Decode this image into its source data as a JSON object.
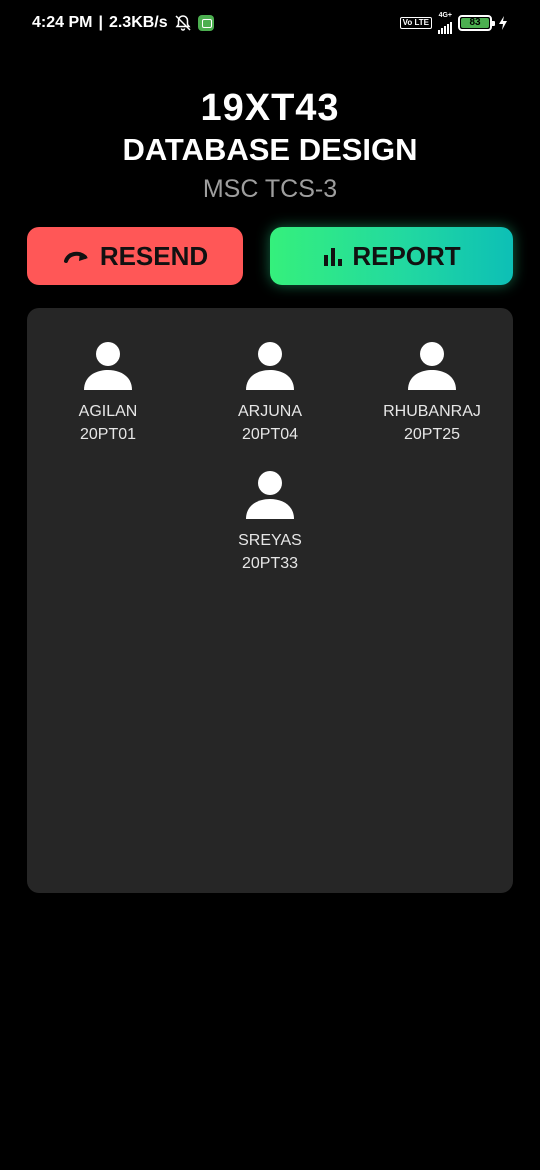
{
  "status_bar": {
    "time": "4:24 PM",
    "speed": "2.3KB/s",
    "volte": "Vo LTE",
    "network": "4G+",
    "battery": "83"
  },
  "course": {
    "code": "19XT43",
    "name": "DATABASE DESIGN",
    "group": "MSC TCS-3"
  },
  "buttons": {
    "resend": "RESEND",
    "report": "REPORT"
  },
  "members": [
    {
      "name": "AGILAN",
      "id": "20PT01"
    },
    {
      "name": "ARJUNA",
      "id": "20PT04"
    },
    {
      "name": "RHUBANRAJ",
      "id": "20PT25"
    },
    {
      "name": "SREYAS",
      "id": "20PT33"
    }
  ],
  "colors": {
    "resend": "#ff5757",
    "report_start": "#35f07c",
    "report_end": "#0dbfb6",
    "panel": "#262626"
  }
}
